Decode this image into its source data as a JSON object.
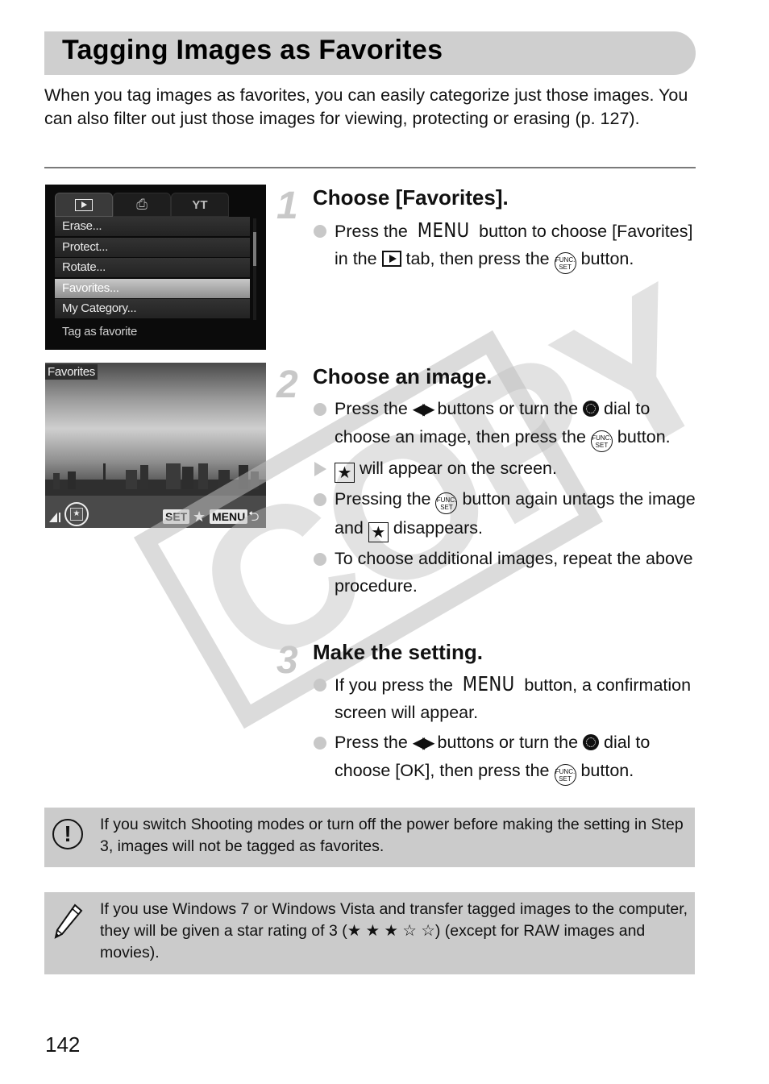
{
  "header": {
    "title": "Tagging Images as Favorites",
    "intro": "When you tag images as favorites, you can easily categorize just those images. You can also filter out just those images for viewing, protecting or erasing (p. 127)."
  },
  "screen1": {
    "tabs": [
      "playback-tab",
      "print-tab",
      "settings-tab"
    ],
    "active_tab": "playback-tab",
    "menu_items": [
      "Erase...",
      "Protect...",
      "Rotate...",
      "Favorites...",
      "My Category..."
    ],
    "selected_item": "Favorites...",
    "hint": "Tag as favorite"
  },
  "screen2": {
    "label": "Favorites",
    "set_label": "SET",
    "menu_label": "MENU",
    "star": "★",
    "back": "⮌"
  },
  "steps": [
    {
      "number": "1",
      "title": "Choose [Favorites].",
      "bullets": [
        {
          "type": "dot",
          "parts": [
            "Press the ",
            "{MENU}",
            " button to choose [Favorites] in the ",
            "{PLAY}",
            " tab, then press the ",
            "{FUNC}",
            " button."
          ]
        }
      ]
    },
    {
      "number": "2",
      "title": "Choose an image.",
      "bullets": [
        {
          "type": "dot",
          "parts": [
            "Press the ",
            "{LR}",
            " buttons or turn the ",
            "{DIAL}",
            " dial to choose an image, then press the ",
            "{FUNC}",
            " button."
          ]
        },
        {
          "type": "arrow",
          "parts": [
            "{STAR}",
            " will appear on the screen."
          ]
        },
        {
          "type": "dot",
          "parts": [
            "Pressing the ",
            "{FUNC}",
            " button again untags the image and ",
            "{STAR}",
            " disappears."
          ]
        },
        {
          "type": "dot",
          "parts": [
            "To choose additional images, repeat the above procedure."
          ]
        }
      ]
    },
    {
      "number": "3",
      "title": "Make the setting.",
      "bullets": [
        {
          "type": "dot",
          "parts": [
            "If you press the ",
            "{MENU}",
            " button, a confirmation screen will appear."
          ]
        },
        {
          "type": "dot",
          "parts": [
            "Press the ",
            "{LR}",
            " buttons or turn the ",
            "{DIAL}",
            " dial to choose [OK], then press the ",
            "{FUNC}",
            " button."
          ]
        }
      ]
    }
  ],
  "symbols": {
    "menu": "MENU",
    "func_top": "FUNC.",
    "func_bottom": "SET",
    "lr": "◀▶",
    "star": "★"
  },
  "notes": {
    "caution": "If you switch Shooting modes or turn off the power before making the setting in Step 3, images will not be tagged as favorites.",
    "memo": "If you use Windows 7 or Windows Vista and transfer tagged images to the computer, they will be given a star rating of 3 (★ ★ ★ ☆ ☆) (except for RAW images and movies)."
  },
  "watermark": "COPY",
  "page_number": "142"
}
